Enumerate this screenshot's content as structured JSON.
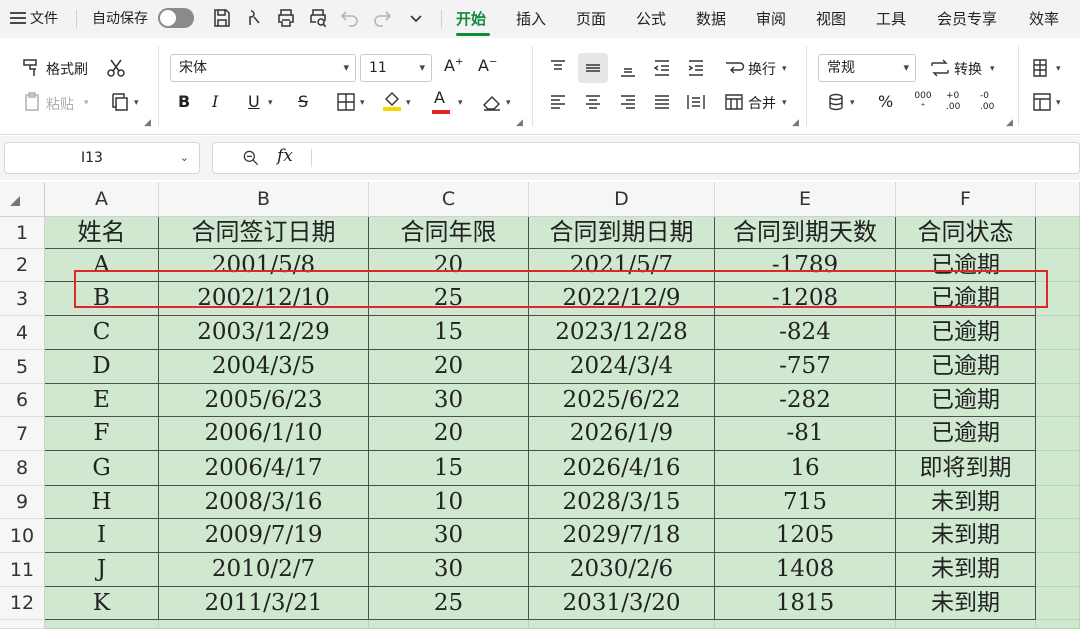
{
  "menu": {
    "file": "文件",
    "autosave": "自动保存",
    "tabs": [
      "开始",
      "插入",
      "页面",
      "公式",
      "数据",
      "审阅",
      "视图",
      "工具",
      "会员专享",
      "效率"
    ],
    "active_tab": "开始"
  },
  "ribbon": {
    "format_painter": "格式刷",
    "paste": "粘贴",
    "font_name": "宋体",
    "font_size": "11",
    "wrap": "换行",
    "merge": "合并",
    "number_format": "常规",
    "convert": "转换",
    "percent": "%",
    "thousands": "000",
    "inc_decimal": "+0 .00",
    "dec_decimal": "-0 .00",
    "bold": "B",
    "italic": "I",
    "underline": "U",
    "strike": "S",
    "font_color_letter": "A",
    "accent_green": "#108a3c",
    "font_color_red": "#e0262b",
    "highlight_yellow": "#f5d800"
  },
  "formula_bar": {
    "cell_ref": "I13",
    "fx": "fx",
    "content": ""
  },
  "sheet": {
    "columns": [
      "A",
      "B",
      "C",
      "D",
      "E",
      "F"
    ],
    "rows": [
      "1",
      "2",
      "3",
      "4",
      "5",
      "6",
      "7",
      "8",
      "9",
      "10",
      "11",
      "12"
    ],
    "header": [
      "姓名",
      "合同签订日期",
      "合同年限",
      "合同到期日期",
      "合同到期天数",
      "合同状态"
    ],
    "data": [
      [
        "A",
        "2001/5/8",
        "20",
        "2021/5/7",
        "-1789",
        "已逾期"
      ],
      [
        "B",
        "2002/12/10",
        "25",
        "2022/12/9",
        "-1208",
        "已逾期"
      ],
      [
        "C",
        "2003/12/29",
        "15",
        "2023/12/28",
        "-824",
        "已逾期"
      ],
      [
        "D",
        "2004/3/5",
        "20",
        "2024/3/4",
        "-757",
        "已逾期"
      ],
      [
        "E",
        "2005/6/23",
        "30",
        "2025/6/22",
        "-282",
        "已逾期"
      ],
      [
        "F",
        "2006/1/10",
        "20",
        "2026/1/9",
        "-81",
        "已逾期"
      ],
      [
        "G",
        "2006/4/17",
        "15",
        "2026/4/16",
        "16",
        "即将到期"
      ],
      [
        "H",
        "2008/3/16",
        "10",
        "2028/3/15",
        "715",
        "未到期"
      ],
      [
        "I",
        "2009/7/19",
        "30",
        "2029/7/18",
        "1205",
        "未到期"
      ],
      [
        "J",
        "2010/2/7",
        "30",
        "2030/2/6",
        "1408",
        "未到期"
      ],
      [
        "K",
        "2011/3/21",
        "25",
        "2031/3/20",
        "1815",
        "未到期"
      ]
    ],
    "cell_fill": "#cfe8cf",
    "highlight_border": "#e0262b"
  }
}
